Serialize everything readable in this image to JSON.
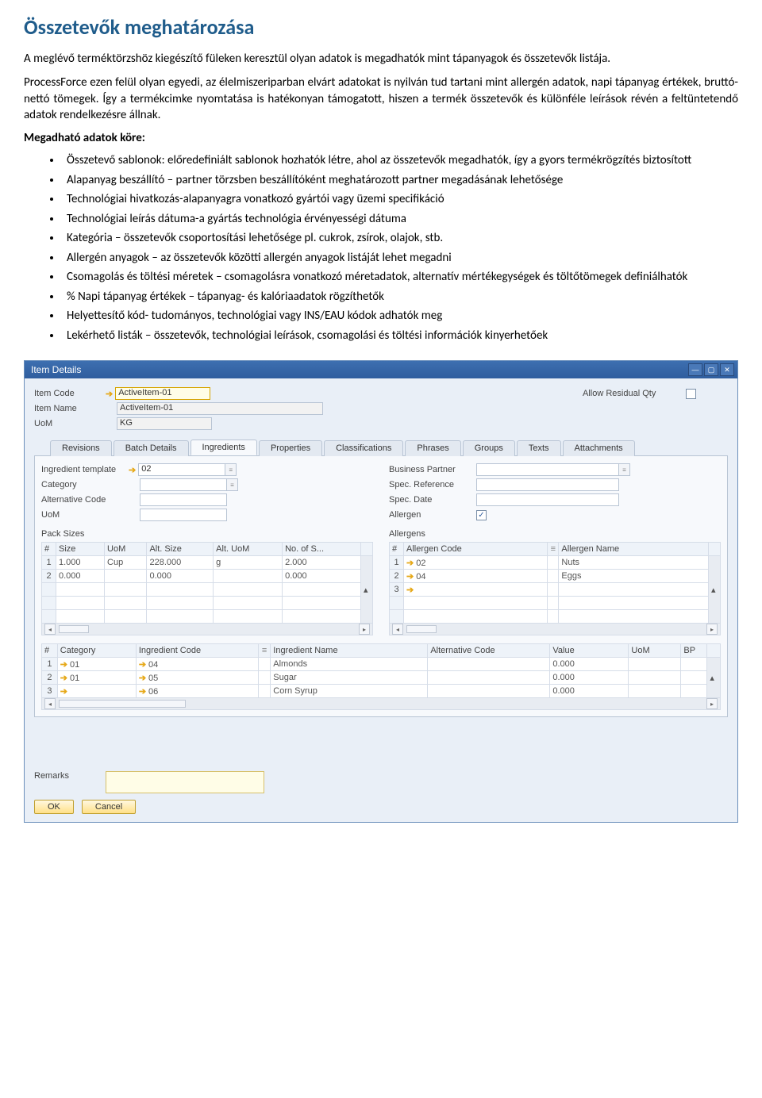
{
  "doc": {
    "heading": "Összetevők meghatározása",
    "para1": "A meglévő terméktörzshöz kiegészítő füleken keresztül olyan adatok is megadhatók mint tápanyagok és összetevők listája.",
    "para2": "ProcessForce ezen felül olyan egyedi, az élelmiszeriparban elvárt adatokat is nyilván tud tartani mint allergén adatok, napi tápanyag értékek, bruttó-nettó tömegek. Így a termékcimke nyomtatása is hatékonyan támogatott, hiszen a termék összetevők és különféle leírások révén a feltüntetendő adatok rendelkezésre állnak.",
    "subhead": "Megadható adatok köre:",
    "bullets": [
      "Összetevő sablonok: előredefiniált sablonok hozhatók létre, ahol az összetevők megadhatók, így a gyors termékrögzítés biztosított",
      "Alapanyag beszállító – partner törzsben beszállítóként meghatározott partner megadásának lehetősége",
      "Technológiai hivatkozás-alapanyagra vonatkozó gyártói vagy üzemi specifikáció",
      "Technológiai leírás dátuma-a gyártás technológia érvényességi dátuma",
      "Kategória – összetevők csoportosítási lehetősége pl. cukrok, zsírok, olajok, stb.",
      "Allergén anyagok – az összetevők közötti allergén anyagok listáját lehet megadni",
      "Csomagolás és töltési méretek – csomagolásra vonatkozó méretadatok, alternatív mértékegységek és töltőtömegek definiálhatók",
      "% Napi tápanyag értékek – tápanyag- és kalóriaadatok rögzíthetők",
      "Helyettesítő kód- tudományos, technológiai vagy INS/EAU kódok adhatók meg",
      "Lekérhető listák – összetevők, technológiai leírások, csomagolási és töltési információk kinyerhetőek"
    ]
  },
  "app": {
    "windowTitle": "Item Details",
    "header": {
      "code_lbl": "Item Code",
      "code_val": "ActiveItem-01",
      "name_lbl": "Item Name",
      "name_val": "ActiveItem-01",
      "uom_lbl": "UoM",
      "uom_val": "KG",
      "residual_lbl": "Allow Residual Qty"
    },
    "tabs": [
      "Revisions",
      "Batch Details",
      "Ingredients",
      "Properties",
      "Classifications",
      "Phrases",
      "Groups",
      "Texts",
      "Attachments"
    ],
    "leftFields": {
      "tmpl_lbl": "Ingredient template",
      "tmpl_val": "02",
      "cat_lbl": "Category",
      "altcode_lbl": "Alternative Code",
      "uom2_lbl": "UoM",
      "pack_lbl": "Pack Sizes"
    },
    "rightFields": {
      "bp_lbl": "Business Partner",
      "specref_lbl": "Spec. Reference",
      "specdate_lbl": "Spec. Date",
      "allergen_lbl": "Allergen",
      "allergens_lbl": "Allergens",
      "allergen_checked": "✓"
    },
    "packTable": {
      "headers": {
        "num": "#",
        "size": "Size",
        "uom": "UoM",
        "altsize": "Alt. Size",
        "altuom": "Alt. UoM",
        "nos": "No. of S..."
      },
      "rows": [
        {
          "n": "1",
          "size": "1.000",
          "uom": "Cup",
          "altsize": "228.000",
          "altuom": "g",
          "nos": "2.000"
        },
        {
          "n": "2",
          "size": "0.000",
          "uom": "",
          "altsize": "0.000",
          "altuom": "",
          "nos": "0.000"
        }
      ]
    },
    "allergenTable": {
      "headers": {
        "num": "#",
        "code": "Allergen Code",
        "name": "Allergen Name"
      },
      "rows": [
        {
          "n": "1",
          "code": "02",
          "name": "Nuts"
        },
        {
          "n": "2",
          "code": "04",
          "name": "Eggs"
        },
        {
          "n": "3",
          "code": "",
          "name": ""
        }
      ]
    },
    "ingrTable": {
      "headers": {
        "num": "#",
        "cat": "Category",
        "code": "Ingredient Code",
        "name": "Ingredient Name",
        "altcode": "Alternative Code",
        "value": "Value",
        "uom": "UoM",
        "bp": "BP"
      },
      "rows": [
        {
          "n": "1",
          "cat": "01",
          "code": "04",
          "name": "Almonds",
          "altcode": "",
          "value": "0.000",
          "uom": "",
          "bp": ""
        },
        {
          "n": "2",
          "cat": "01",
          "code": "05",
          "name": "Sugar",
          "altcode": "",
          "value": "0.000",
          "uom": "",
          "bp": ""
        },
        {
          "n": "3",
          "cat": "",
          "code": "06",
          "name": "Corn Syrup",
          "altcode": "",
          "value": "0.000",
          "uom": "",
          "bp": ""
        }
      ]
    },
    "remarks_lbl": "Remarks",
    "btn_ok": "OK",
    "btn_cancel": "Cancel"
  }
}
